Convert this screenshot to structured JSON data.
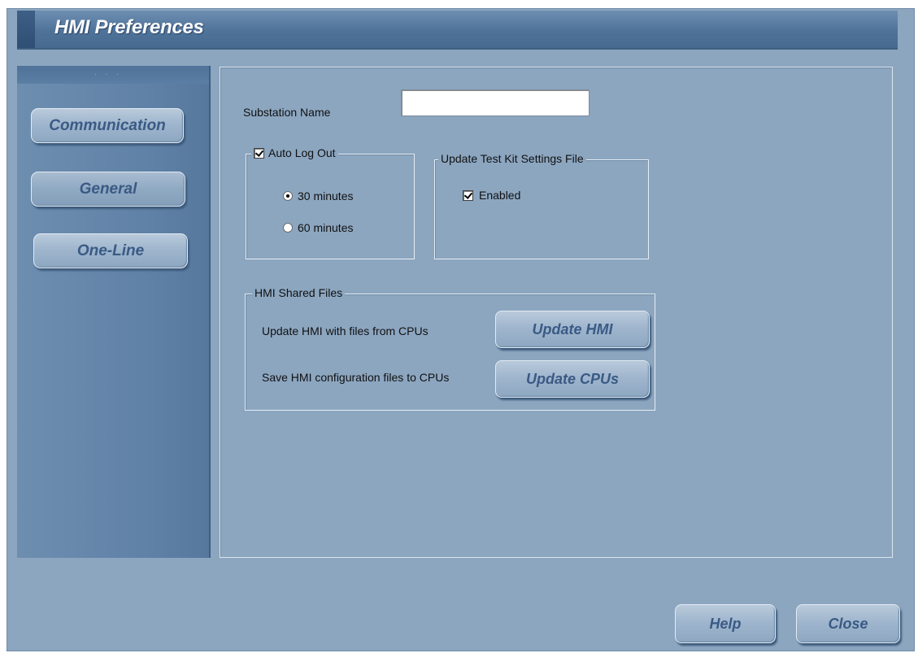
{
  "window": {
    "title": "HMI Preferences"
  },
  "sidebar": {
    "items": [
      {
        "label": "Communication",
        "selected": false
      },
      {
        "label": "General",
        "selected": true
      },
      {
        "label": "One-Line",
        "selected": false
      }
    ]
  },
  "general": {
    "substation_name_label": "Substation Name",
    "substation_name_value": "",
    "auto_logout": {
      "label": "Auto Log Out",
      "checked": true,
      "options": [
        {
          "label": "30 minutes",
          "selected": true
        },
        {
          "label": "60 minutes",
          "selected": false
        }
      ]
    },
    "test_kit": {
      "label": "Update Test Kit Settings File",
      "enabled_label": "Enabled",
      "enabled_checked": true
    },
    "shared_files": {
      "label": "HMI Shared Files",
      "update_hmi_text": "Update HMI with files from CPUs",
      "update_hmi_button": "Update HMI",
      "save_cpus_text": "Save HMI configuration files to CPUs",
      "update_cpus_button": "Update CPUs"
    }
  },
  "footer": {
    "help_label": "Help",
    "close_label": "Close"
  },
  "colors": {
    "window_bg": "#8ca6c0",
    "titlebar": "#4f7299",
    "button_text": "#3a5a85"
  }
}
